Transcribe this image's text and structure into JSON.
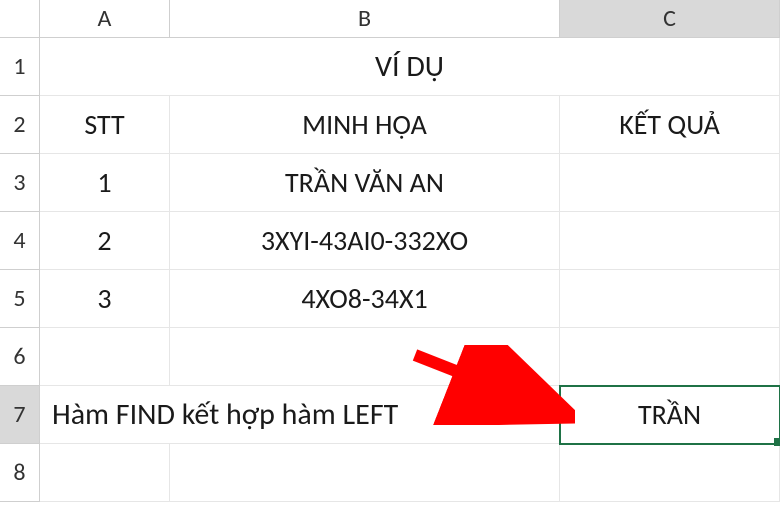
{
  "columns": {
    "A": "A",
    "B": "B",
    "C": "C"
  },
  "rows": {
    "r1": "1",
    "r2": "2",
    "r3": "3",
    "r4": "4",
    "r5": "5",
    "r6": "6",
    "r7": "7",
    "r8": "8"
  },
  "selected": {
    "col": "C",
    "row": "7"
  },
  "cells": {
    "row1_merged": "VÍ DỤ",
    "A2": "STT",
    "B2": "MINH HỌA",
    "C2": "KẾT QUẢ",
    "A3": "1",
    "B3": "TRẦN VĂN AN",
    "A4": "2",
    "B4": "3XYI-43AI0-332XO",
    "A5": "3",
    "B5": "4XO8-34X1",
    "row7_AB": "Hàm FIND kết hợp hàm LEFT",
    "C7": "TRẦN"
  },
  "annotation": {
    "arrow_color": "#ff0000"
  }
}
